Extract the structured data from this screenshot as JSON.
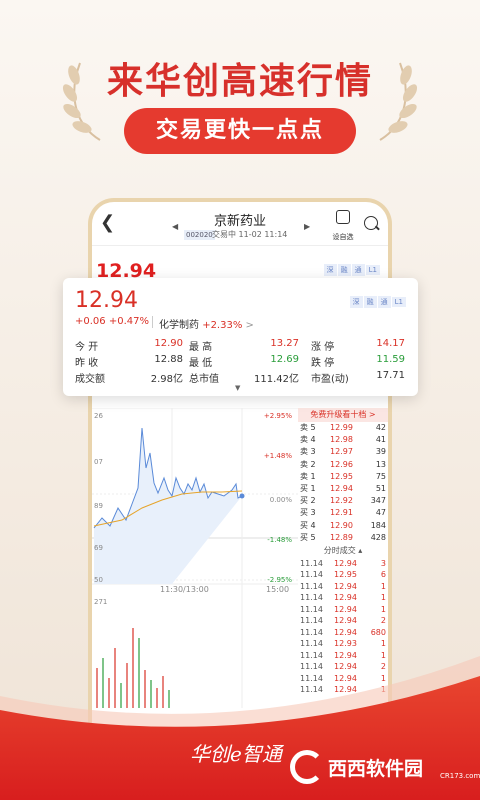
{
  "promo": {
    "headline": "来华创高速行情",
    "subheadline": "交易更快一点点",
    "slogan": "华创e智通",
    "watermark_name": "西西软件园",
    "watermark_url": "CR173.com"
  },
  "colors": {
    "accent": "#e53a2f",
    "up": "#d93026",
    "down": "#2a9d3a",
    "frame": "#e9d4ad"
  },
  "header": {
    "back_icon": "chevron-left-icon",
    "stock_name": "京新药业",
    "stock_code": "002020",
    "status": "交易中 11-02 11:14",
    "self_select_label": "设自选"
  },
  "bg_price": "12.94",
  "tags": [
    "深",
    "融",
    "通",
    "L1"
  ],
  "card": {
    "price": "12.94",
    "change": "+0.06",
    "change_pct": "+0.47%",
    "sector": "化学制药",
    "sector_pct": "+2.33%",
    "sector_arrow": ">",
    "rows": [
      {
        "l1": "今 开",
        "v1": "12.90",
        "l2": "最 高",
        "v2": "13.27",
        "l3": "涨 停",
        "v3": "14.17"
      },
      {
        "l1": "昨 收",
        "v1": "12.88",
        "l2": "最 低",
        "v2": "12.69",
        "l3": "跌 停",
        "v3": "11.59"
      },
      {
        "l1": "成交额",
        "v1": "2.98亿",
        "l2": "总市值",
        "v2": "111.42亿",
        "l3": "市盈(动)",
        "v3": "17.71"
      }
    ]
  },
  "chart": {
    "left_labels": [
      "26",
      "07",
      "89",
      "69",
      "50"
    ],
    "right_labels": [
      "+2.95%",
      "+1.48%",
      "0.00%",
      "-1.48%",
      "-2.95%"
    ],
    "x_labels": [
      "11:30/13:00",
      "15:00"
    ],
    "vol_label": "271"
  },
  "orderbook": {
    "upgrade_label": "免费升级看十档",
    "upgrade_arrow": ">",
    "asks": [
      {
        "label": "卖 5",
        "price": "12.99",
        "vol": "42"
      },
      {
        "label": "卖 4",
        "price": "12.98",
        "vol": "41"
      },
      {
        "label": "卖 3",
        "price": "12.97",
        "vol": "39"
      },
      {
        "label": "卖 2",
        "price": "12.96",
        "vol": "13"
      },
      {
        "label": "卖 1",
        "price": "12.95",
        "vol": "75"
      }
    ],
    "bids": [
      {
        "label": "买 1",
        "price": "12.94",
        "vol": "51"
      },
      {
        "label": "买 2",
        "price": "12.92",
        "vol": "347"
      },
      {
        "label": "买 3",
        "price": "12.91",
        "vol": "47"
      },
      {
        "label": "买 4",
        "price": "12.90",
        "vol": "184"
      },
      {
        "label": "买 5",
        "price": "12.89",
        "vol": "428"
      }
    ],
    "ticks_title": "分时成交",
    "ticks": [
      {
        "time": "11.14",
        "price": "12.94",
        "vol": "3"
      },
      {
        "time": "11.14",
        "price": "12.95",
        "vol": "6"
      },
      {
        "time": "11.14",
        "price": "12.94",
        "vol": "1"
      },
      {
        "time": "11.14",
        "price": "12.94",
        "vol": "1"
      },
      {
        "time": "11.14",
        "price": "12.94",
        "vol": "1"
      },
      {
        "time": "11.14",
        "price": "12.94",
        "vol": "2"
      },
      {
        "time": "11.14",
        "price": "12.94",
        "vol": "680"
      },
      {
        "time": "11.14",
        "price": "12.93",
        "vol": "1"
      },
      {
        "time": "11.14",
        "price": "12.94",
        "vol": "1"
      },
      {
        "time": "11.14",
        "price": "12.94",
        "vol": "2"
      },
      {
        "time": "11.14",
        "price": "12.94",
        "vol": "1"
      },
      {
        "time": "11.14",
        "price": "12.94",
        "vol": "1"
      }
    ]
  }
}
